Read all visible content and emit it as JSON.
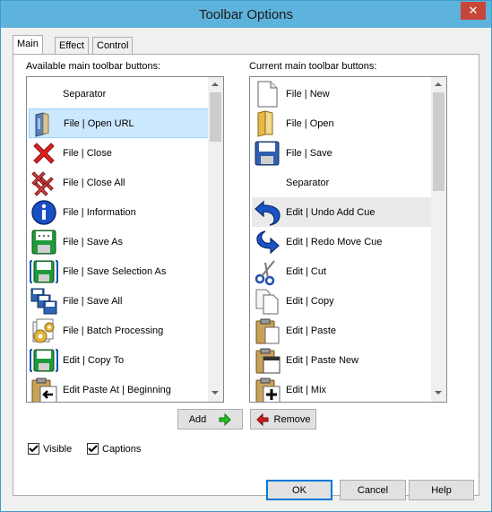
{
  "window": {
    "title": "Toolbar Options",
    "close_glyph": "✕"
  },
  "tabs": [
    {
      "label": "Main",
      "active": true
    },
    {
      "label": "Effect",
      "active": false
    },
    {
      "label": "Control",
      "active": false
    }
  ],
  "available": {
    "label": "Available main toolbar buttons:",
    "items": [
      {
        "label": "Separator",
        "icon": "none"
      },
      {
        "label": "File | Open URL",
        "icon": "open-url-icon",
        "selected": true
      },
      {
        "label": "File | Close",
        "icon": "close-x-icon"
      },
      {
        "label": "File | Close All",
        "icon": "close-all-icon"
      },
      {
        "label": "File | Information",
        "icon": "information-icon"
      },
      {
        "label": "File | Save As",
        "icon": "save-as-icon"
      },
      {
        "label": "File | Save Selection As",
        "icon": "save-selection-icon"
      },
      {
        "label": "File | Save All",
        "icon": "save-all-icon"
      },
      {
        "label": "File | Batch Processing",
        "icon": "batch-processing-icon"
      },
      {
        "label": "Edit | Copy To",
        "icon": "copy-to-icon"
      },
      {
        "label": "Edit Paste At | Beginning",
        "icon": "paste-beginning-icon"
      }
    ]
  },
  "current": {
    "label": "Current main toolbar buttons:",
    "items": [
      {
        "label": "File | New",
        "icon": "new-file-icon"
      },
      {
        "label": "File | Open",
        "icon": "open-folder-icon"
      },
      {
        "label": "File | Save",
        "icon": "save-icon"
      },
      {
        "label": "Separator",
        "icon": "none"
      },
      {
        "label": "Edit | Undo Add Cue",
        "icon": "undo-icon",
        "hover": true
      },
      {
        "label": "Edit | Redo Move Cue",
        "icon": "redo-icon"
      },
      {
        "label": "Edit | Cut",
        "icon": "scissors-icon"
      },
      {
        "label": "Edit | Copy",
        "icon": "copy-icon"
      },
      {
        "label": "Edit | Paste",
        "icon": "paste-icon"
      },
      {
        "label": "Edit | Paste New",
        "icon": "paste-new-icon"
      },
      {
        "label": "Edit | Mix",
        "icon": "mix-icon"
      }
    ]
  },
  "buttons": {
    "add": "Add",
    "remove": "Remove",
    "ok": "OK",
    "cancel": "Cancel",
    "help": "Help"
  },
  "options": {
    "visible": "Visible",
    "visible_checked": true,
    "captions": "Captions",
    "captions_checked": true
  },
  "colors": {
    "selection": "#cce8ff",
    "title_bar": "#5eb3dc",
    "close": "#c7463a",
    "add_arrow": "#22c422",
    "remove_arrow": "#d01c1c"
  }
}
